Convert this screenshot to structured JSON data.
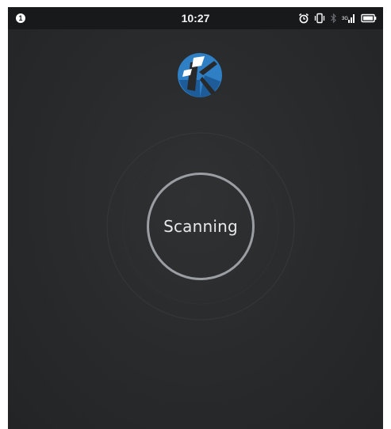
{
  "status_bar": {
    "time": "10:27",
    "notification_badge": "1",
    "icons": [
      "alarm-icon",
      "vibrate-icon",
      "bluetooth-icon",
      "signal-icon",
      "battery-icon"
    ]
  },
  "app": {
    "logo": "app-logo-k-icon",
    "scan_label": "Scanning"
  },
  "colors": {
    "background": "#27292b",
    "status_bar": "#17191b",
    "ring": "#9a9ea2",
    "logo_blue": "#2e7fc4",
    "logo_dark_blue": "#1d5c99"
  }
}
